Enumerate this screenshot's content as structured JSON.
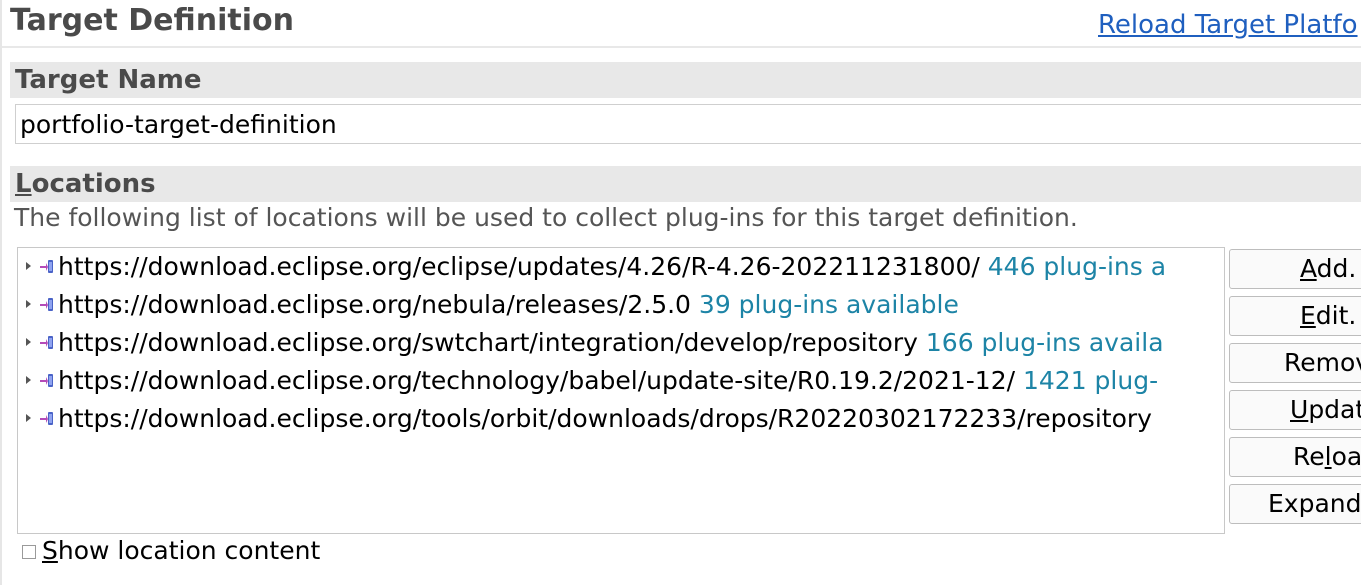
{
  "form": {
    "title": "Target Definition",
    "reload_link": "Reload Target Platfo"
  },
  "target_name": {
    "header": "Target Name",
    "value": "portfolio-target-definition"
  },
  "locations": {
    "header": "Locations",
    "description": "The following list of locations will be used to collect plug-ins for this target definition.",
    "items": [
      {
        "url": "https://download.eclipse.org/eclipse/updates/4.26/R-4.26-202211231800/",
        "status": "446 plug-ins a"
      },
      {
        "url": "https://download.eclipse.org/nebula/releases/2.5.0",
        "status": "39 plug-ins available"
      },
      {
        "url": "https://download.eclipse.org/swtchart/integration/develop/repository",
        "status": "166 plug-ins availa"
      },
      {
        "url": "https://download.eclipse.org/technology/babel/update-site/R0.19.2/2021-12/",
        "status": "1421 plug-"
      },
      {
        "url": "https://download.eclipse.org/tools/orbit/downloads/drops/R20220302172233/repository",
        "status": ""
      }
    ],
    "buttons": {
      "add": {
        "mnemonic": "A",
        "rest": "dd."
      },
      "edit": {
        "mnemonic": "E",
        "rest": "dit."
      },
      "remove": {
        "pre": "Remov",
        "mnemonic": "",
        "rest": ""
      },
      "update": {
        "mnemonic": "U",
        "rest": "pdat"
      },
      "reload": {
        "pre": "Re",
        "mnemonic": "l",
        "rest": "oa"
      },
      "expand": {
        "pre": "Expand",
        "mnemonic": "",
        "rest": ""
      }
    },
    "show_content": {
      "mnemonic": "S",
      "rest": "how location content",
      "checked": false
    }
  },
  "colors": {
    "link": "#1f5fbf",
    "status_text": "#1d84a6",
    "section_bg": "#e8e8e8",
    "header_text": "#4a4a4a"
  },
  "icons": {
    "twisty": "chevron-right-icon",
    "location": "repository-icon"
  }
}
